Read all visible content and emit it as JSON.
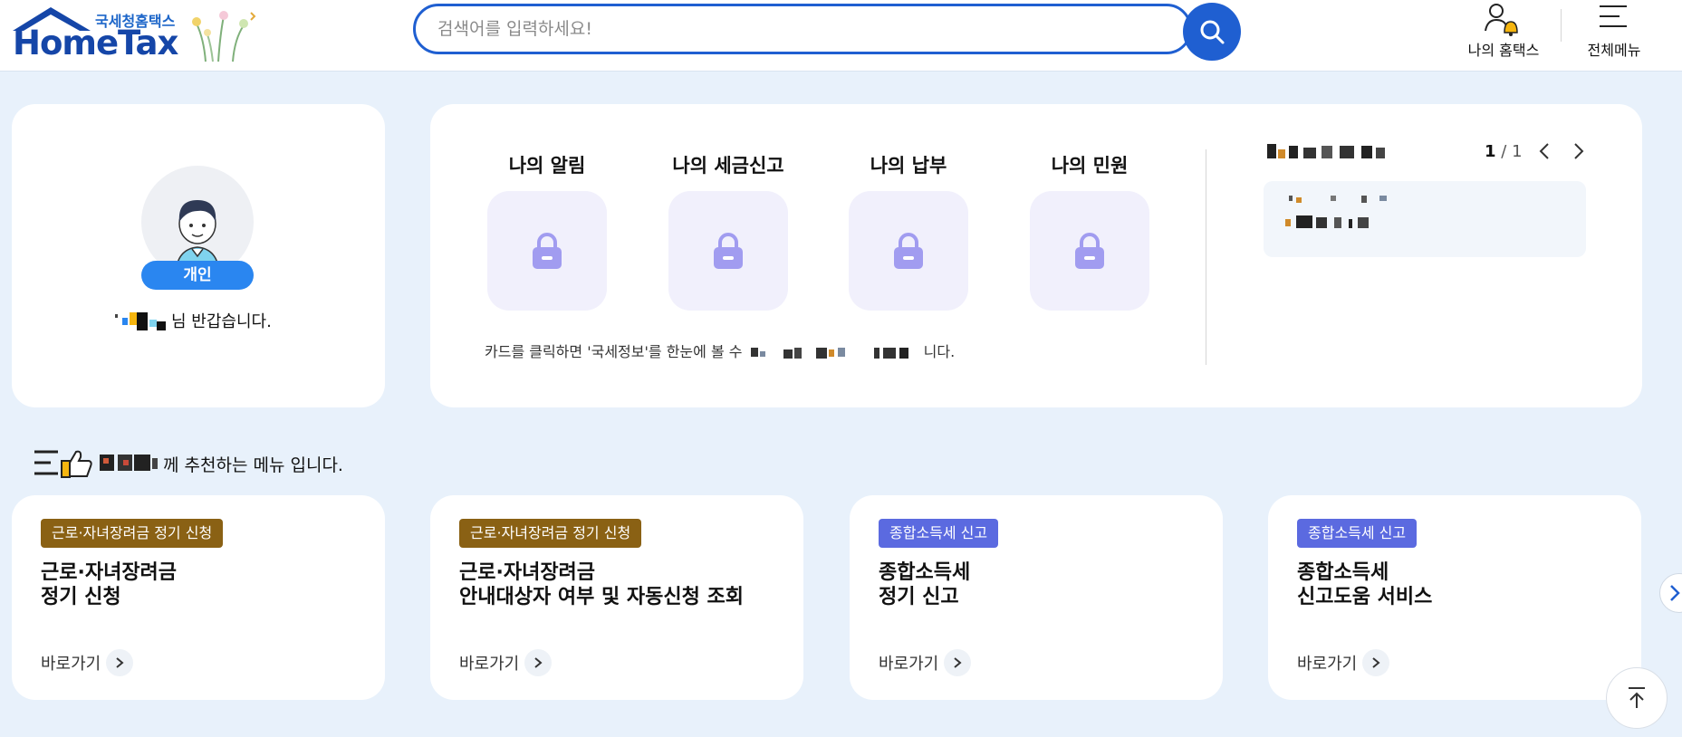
{
  "header": {
    "logo_sub": "국세청홈택스",
    "logo_brand": "HomeTax",
    "search_placeholder": "검색어를 입력하세요!",
    "my_hometax_label": "나의 홈택스",
    "all_menu_label": "전체메뉴"
  },
  "profile": {
    "role_label": "개인",
    "greeting_suffix": "님 반갑습니다."
  },
  "info_panel": {
    "tiles": [
      {
        "label": "나의 알림",
        "icon": "lock-icon"
      },
      {
        "label": "나의 세금신고",
        "icon": "lock-icon"
      },
      {
        "label": "나의 납부",
        "icon": "lock-icon"
      },
      {
        "label": "나의 민원",
        "icon": "lock-icon"
      }
    ],
    "note_prefix": "카드를 클릭하면 '국세정보'를 한눈에 볼 수",
    "note_suffix": "니다.",
    "pager_current": "1",
    "pager_sep": "/",
    "pager_total": "1"
  },
  "recommend": {
    "text_suffix": "께 추천하는 메뉴 입니다."
  },
  "menu_cards": [
    {
      "tag": "근로·자녀장려금 정기 신청",
      "tag_color": "#8a6114",
      "title_line1": "근로·자녀장려금",
      "title_line2": "정기 신청",
      "link": "바로가기"
    },
    {
      "tag": "근로·자녀장려금 정기 신청",
      "tag_color": "#8a6114",
      "title_line1": "근로·자녀장려금",
      "title_line2": "안내대상자 여부 및 자동신청 조회",
      "link": "바로가기"
    },
    {
      "tag": "종합소득세 신고",
      "tag_color": "#5b6ae0",
      "title_line1": "종합소득세",
      "title_line2": "정기 신고",
      "link": "바로가기"
    },
    {
      "tag": "종합소득세 신고",
      "tag_color": "#5b6ae0",
      "title_line1": "종합소득세",
      "title_line2": "신고도움 서비스",
      "link": "바로가기"
    }
  ],
  "colors": {
    "primary": "#1f5fd1",
    "page_bg": "#e8f1fb",
    "role_pill": "#2a86f0",
    "tile_bg": "#f1f0fc",
    "lock": "#a19cf0"
  }
}
